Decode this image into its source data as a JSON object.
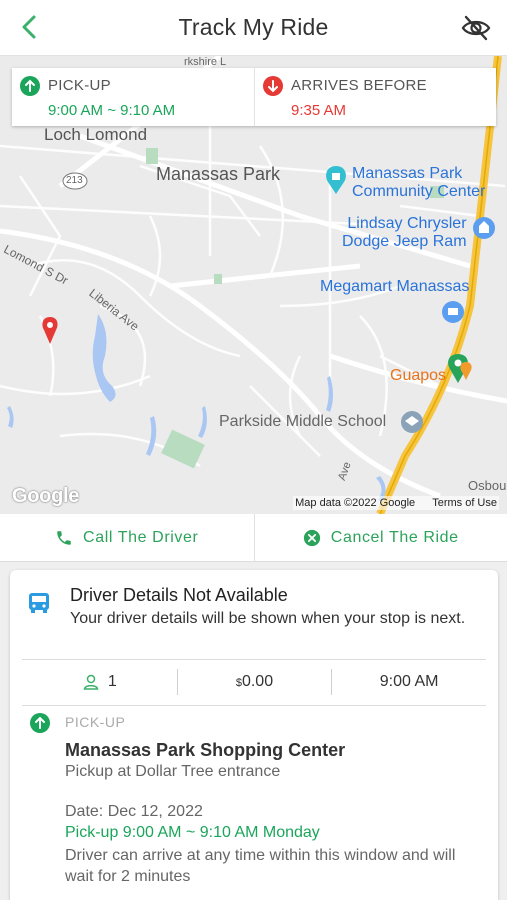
{
  "header": {
    "title": "Track My Ride",
    "back_icon": "chevron-left-icon",
    "visibility_icon": "eye-off-icon"
  },
  "trip_bar": {
    "pickup": {
      "label": "PICK-UP",
      "value": "9:00 AM ~ 9:10 AM",
      "color": "#1aa55a"
    },
    "arrival": {
      "label": "ARRIVES BEFORE",
      "value": "9:35 AM",
      "color": "#e53935"
    }
  },
  "map": {
    "labels": {
      "loch_lomond": "Loch Lomond",
      "manassas_park": "Manassas Park",
      "community_center": [
        "Manassas Park",
        "Community Center"
      ],
      "lindsay": [
        "Lindsay Chrysler",
        "Dodge Jeep Ram"
      ],
      "megamart": "Megamart Manassas",
      "guapos": "Guapos",
      "parkside": "Parkside Middle School",
      "lomond_dr": "Lomond S Dr",
      "liberia_ave": "Liberia Ave",
      "route": "213",
      "osbou": "Osbou",
      "ave": "Ave",
      "kshire": "rkshire L"
    },
    "logo": "Google",
    "attribution": "Map data ©2022 Google",
    "terms": "Terms of Use"
  },
  "actions": {
    "call": "Call The Driver",
    "cancel": "Cancel The Ride"
  },
  "driver": {
    "title": "Driver Details Not Available",
    "subtitle": "Your driver details will be shown when your stop is next."
  },
  "stats": {
    "passengers": "1",
    "fare_currency": "$",
    "fare": "0.00",
    "time": "9:00 AM"
  },
  "pickup_detail": {
    "label": "PICK-UP",
    "location": "Manassas Park Shopping Center",
    "instructions": "Pickup at Dollar Tree entrance",
    "date": "Date: Dec 12, 2022",
    "window": "Pick-up 9:00 AM ~ 9:10 AM Monday",
    "note": "Driver can arrive at any time within this window and will wait for 2 minutes"
  }
}
